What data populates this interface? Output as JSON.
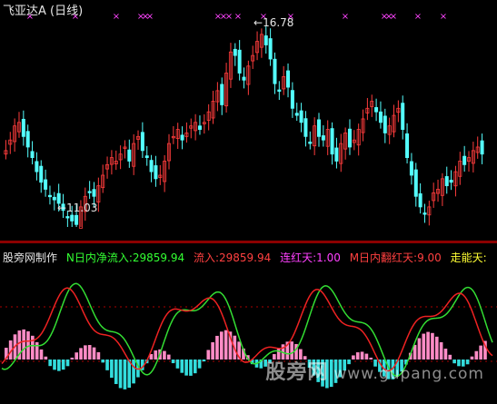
{
  "top_panel": {
    "title": "飞亚达A (日线)",
    "high_label": "16.78",
    "low_label": "11.03",
    "high_arrow": "←",
    "low_arrow": "←",
    "signal_mark": "×"
  },
  "bottom_panel": {
    "indicator_name": "股旁网制作",
    "legend": [
      {
        "text": "N日内净流入:29859.94",
        "color": "#33ff33"
      },
      {
        "text": "流入:29859.94",
        "color": "#ff4040"
      },
      {
        "text": "连红天:1.00",
        "color": "#ff40ff"
      },
      {
        "text": "M日内翻红天:9.00",
        "color": "#ff4040"
      },
      {
        "text": "走能天:",
        "color": "#ffff33"
      }
    ]
  },
  "watermark": {
    "cn": "股旁网",
    "url": "www.gupang.com"
  },
  "colors": {
    "up_candle": "#ff3c3c",
    "down_candle": "#54ffff",
    "signal": "#ff44ff",
    "green_line": "#33dd33",
    "red_line": "#ee2222",
    "pink_bar": "#ff8cc6",
    "cyan_bar": "#33dddd",
    "grid_dots": "#aa0000"
  },
  "chart_data": {
    "type": "candlestick",
    "price_high": 16.78,
    "price_low": 11.03,
    "closes": [
      13.2,
      13.5,
      13.9,
      14.0,
      13.6,
      13.3,
      13.0,
      12.6,
      12.3,
      12.1,
      11.9,
      11.8,
      11.7,
      11.5,
      11.3,
      11.2,
      11.1,
      11.6,
      11.9,
      12.0,
      11.9,
      12.2,
      12.5,
      12.8,
      13.0,
      12.9,
      13.1,
      13.3,
      12.9,
      13.4,
      13.6,
      13.2,
      13.0,
      12.6,
      12.4,
      12.5,
      12.9,
      13.4,
      13.6,
      13.8,
      13.5,
      13.7,
      13.9,
      14.0,
      13.8,
      14.0,
      14.3,
      14.6,
      14.9,
      14.5,
      15.4,
      16.0,
      15.9,
      15.4,
      15.2,
      15.6,
      15.9,
      16.3,
      16.5,
      16.2,
      15.8,
      15.1,
      14.9,
      15.3,
      15.0,
      14.4,
      14.2,
      14.0,
      13.6,
      13.4,
      13.9,
      13.6,
      13.5,
      13.8,
      13.1,
      12.9,
      13.4,
      13.7,
      13.3,
      13.5,
      13.8,
      14.1,
      14.4,
      14.6,
      14.3,
      14.0,
      13.7,
      13.9,
      14.2,
      14.4,
      13.8,
      13.0,
      12.5,
      11.9,
      11.6,
      11.4,
      11.6,
      12.0,
      12.1,
      12.4,
      12.2,
      12.3,
      12.6,
      12.9,
      12.8,
      13.0,
      13.2,
      13.3,
      13.1
    ],
    "signal_marks": 18,
    "inflow_bars": 110
  }
}
